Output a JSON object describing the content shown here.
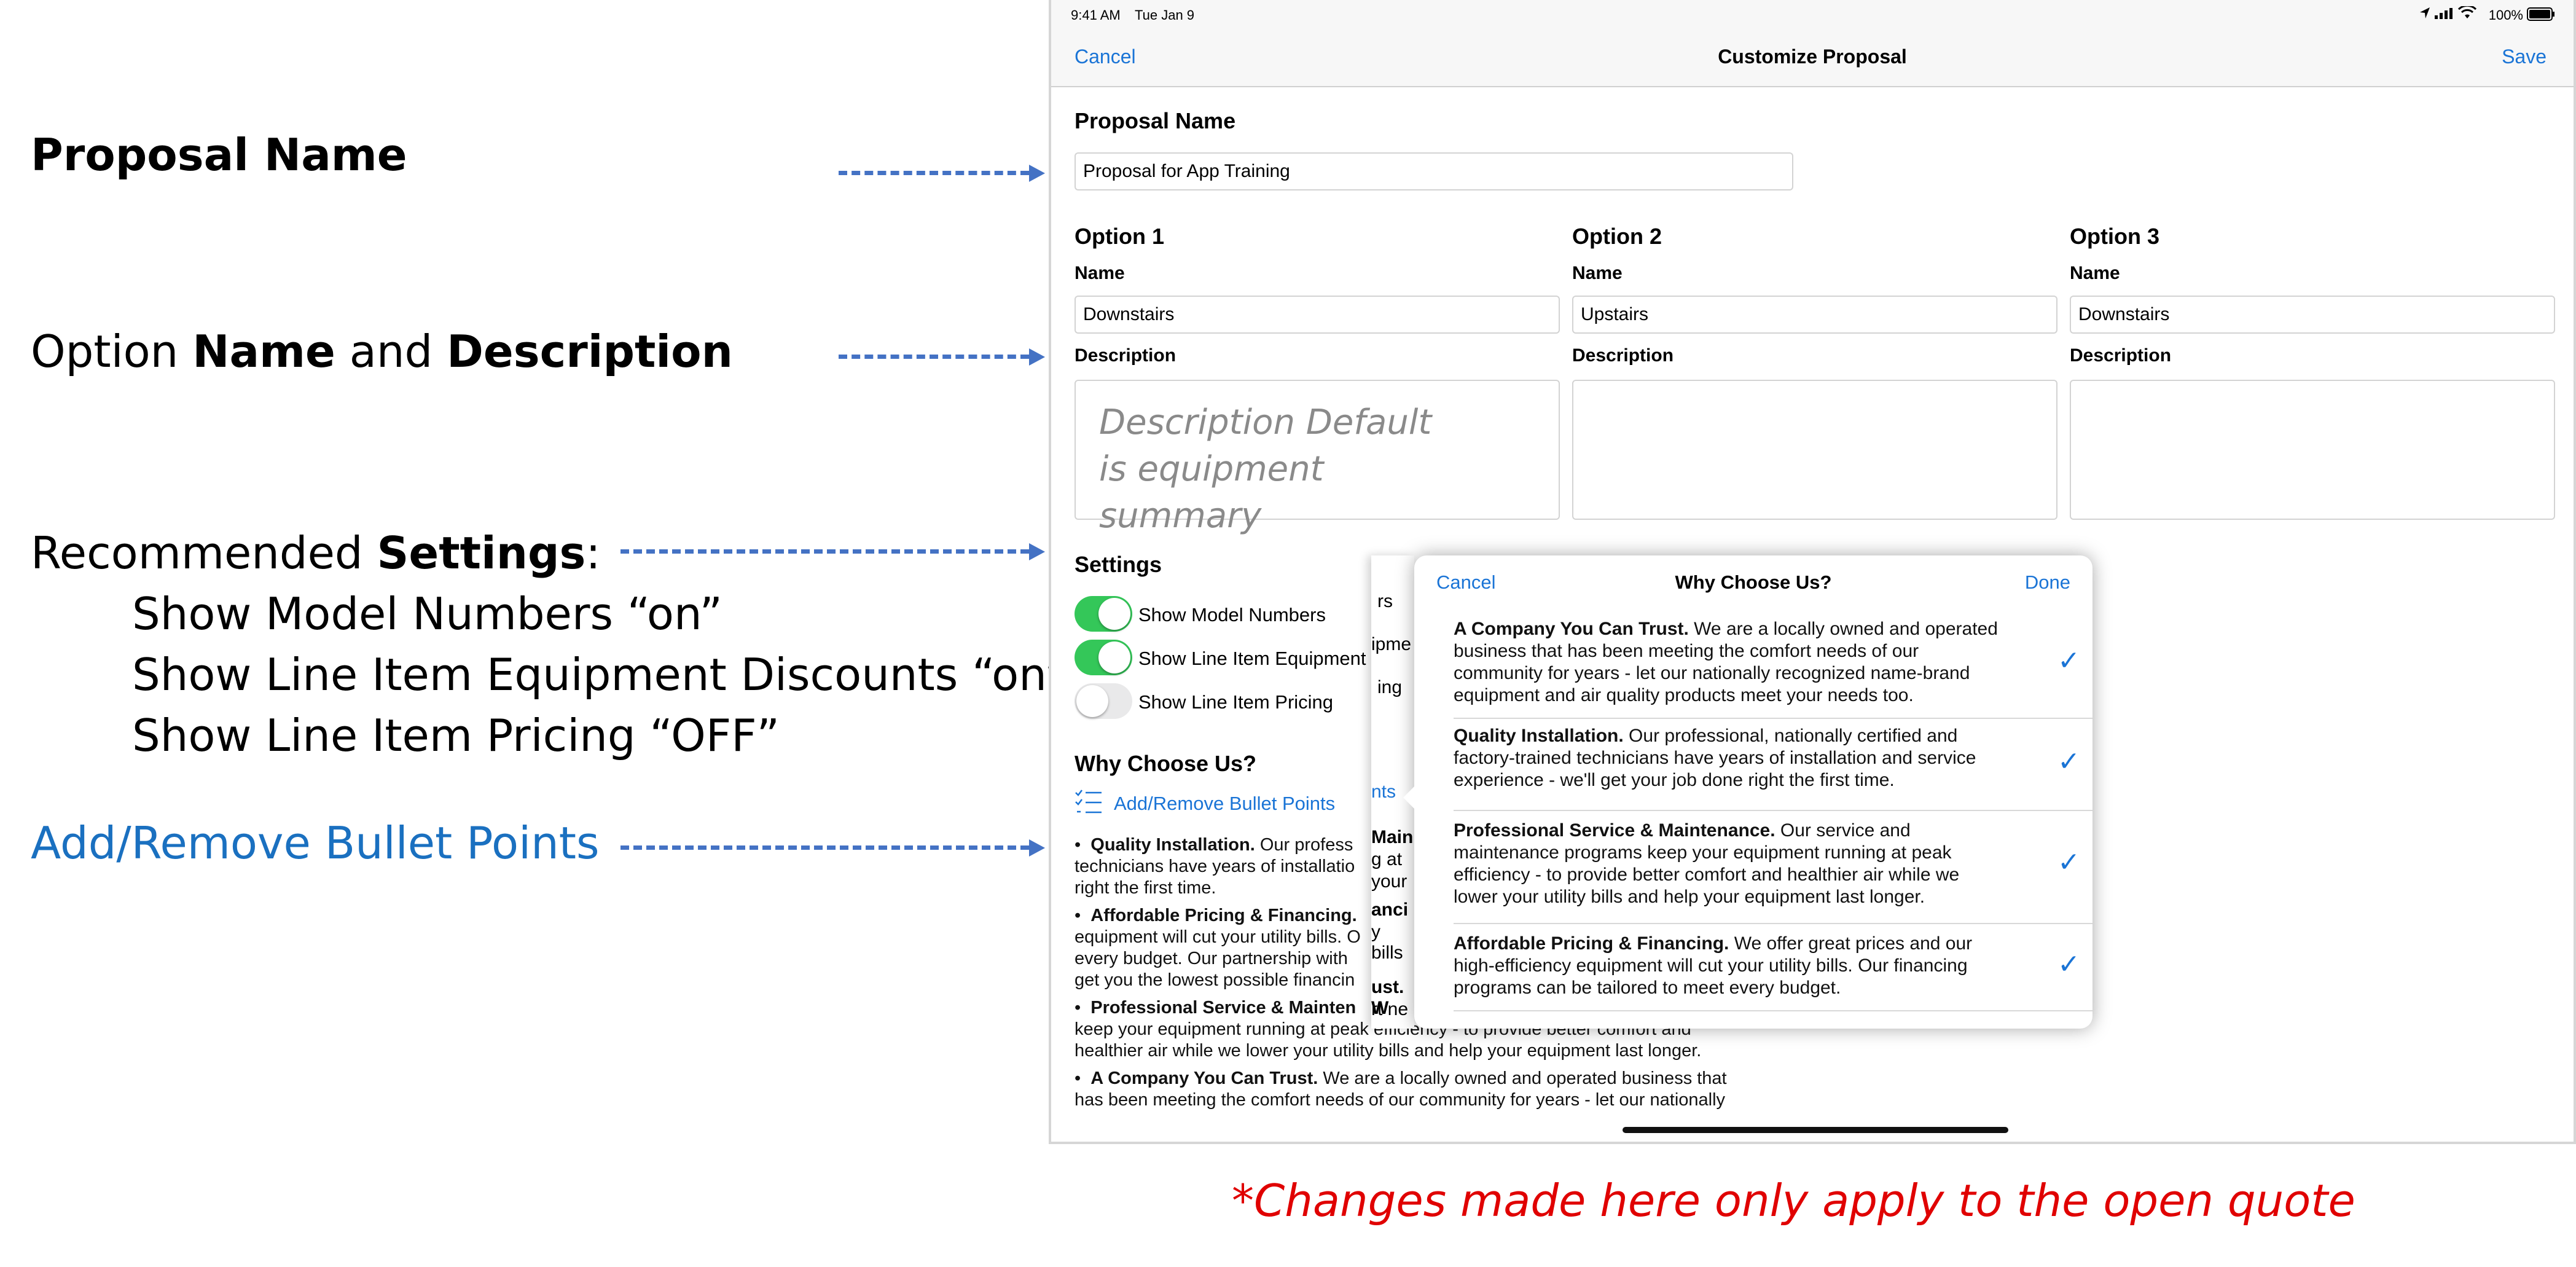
{
  "annotations": {
    "proposal_name": "Proposal Name",
    "option_prefix": "Option",
    "option_name": "Name",
    "option_and": "and",
    "option_description": "Description",
    "recommended_prefix": "Recommended",
    "recommended_settings": "Settings",
    "recommended_colon": ":",
    "line1": "Show Model Numbers “on”",
    "line2": "Show Line Item Equipment Discounts “on”",
    "line3": "Show Line Item Pricing “OFF”",
    "bullet_points": "Add/Remove Bullet Points",
    "footnote": "*Changes made here only apply to the open quote"
  },
  "status_bar": {
    "time": "9:41 AM",
    "date": "Tue Jan 9",
    "battery": "100%"
  },
  "nav": {
    "cancel": "Cancel",
    "title": "Customize Proposal",
    "save": "Save"
  },
  "proposal": {
    "label": "Proposal Name",
    "value": "Proposal for App Training"
  },
  "options": [
    {
      "title": "Option 1",
      "name_label": "Name",
      "name_value": "Downstairs",
      "desc_label": "Description",
      "desc_hint": "Description Default is equipment summary"
    },
    {
      "title": "Option 2",
      "name_label": "Name",
      "name_value": "Upstairs",
      "desc_label": "Description"
    },
    {
      "title": "Option 3",
      "name_label": "Name",
      "name_value": "Downstairs",
      "desc_label": "Description"
    }
  ],
  "settings": {
    "title": "Settings",
    "toggles": [
      {
        "label": "Show Model Numbers",
        "state": "on"
      },
      {
        "label": "Show Line Item Equipment D",
        "state": "on"
      },
      {
        "label": "Show Line Item Pricing",
        "state": "off"
      }
    ],
    "peek": [
      "rs",
      "ipme",
      "ing"
    ]
  },
  "why": {
    "title": "Why Choose Us?",
    "add_remove": "Add/Remove Bullet Points",
    "peek_nts": "nts",
    "bullets": [
      {
        "head": "Quality Installation.",
        "text": " Our profess",
        "cont1": "technicians have years of installatio",
        "cont2": "right the first time."
      },
      {
        "head": "Affordable Pricing & Financing.",
        "text": "",
        "cont1": "equipment will cut your utility bills. O",
        "cont2": "every budget. Our partnership with",
        "cont3": "get you the lowest possible financin"
      },
      {
        "head": "Professional Service & Mainten",
        "text": "",
        "cont1": "keep your equipment running at peak efficiency - to provide better comfort and",
        "cont2": "healthier air while we lower your utility bills and help your equipment last longer."
      },
      {
        "head": "A Company You Can Trust.",
        "text": " We are a locally owned and operated business that",
        "cont1": "has been meeting the comfort needs of our community for years - let our nationally"
      }
    ]
  },
  "popover": {
    "cancel": "Cancel",
    "title": "Why Choose Us?",
    "done": "Done",
    "check": "✓",
    "items": [
      {
        "head": "A Company You Can Trust.",
        "body": " We are a locally owned and operated business that has been meeting the comfort needs of our community for years - let our nationally recognized name-brand equipment and air quality products meet your needs too.",
        "checked": true
      },
      {
        "head": "Quality Installation.",
        "body": " Our professional, nationally certified and factory-trained technicians have years of installation and service experience - we'll get your job done right the first time.",
        "checked": true
      },
      {
        "head": "Professional Service & Maintenance.",
        "body": " Our service and maintenance programs keep your equipment running at peak efficiency - to provide better comfort and healthier air while we lower your utility bills and help your equipment last longer.",
        "checked": true
      },
      {
        "head": "Affordable Pricing & Financing.",
        "body": " We offer great prices and our high-efficiency equipment will cut your utility bills. Our financing programs can be tailored to meet every budget.",
        "checked": true
      }
    ],
    "peek_lines": [
      "Main",
      "g at",
      "your",
      "anci",
      "y bills",
      "ust. W",
      "rt ne"
    ]
  }
}
